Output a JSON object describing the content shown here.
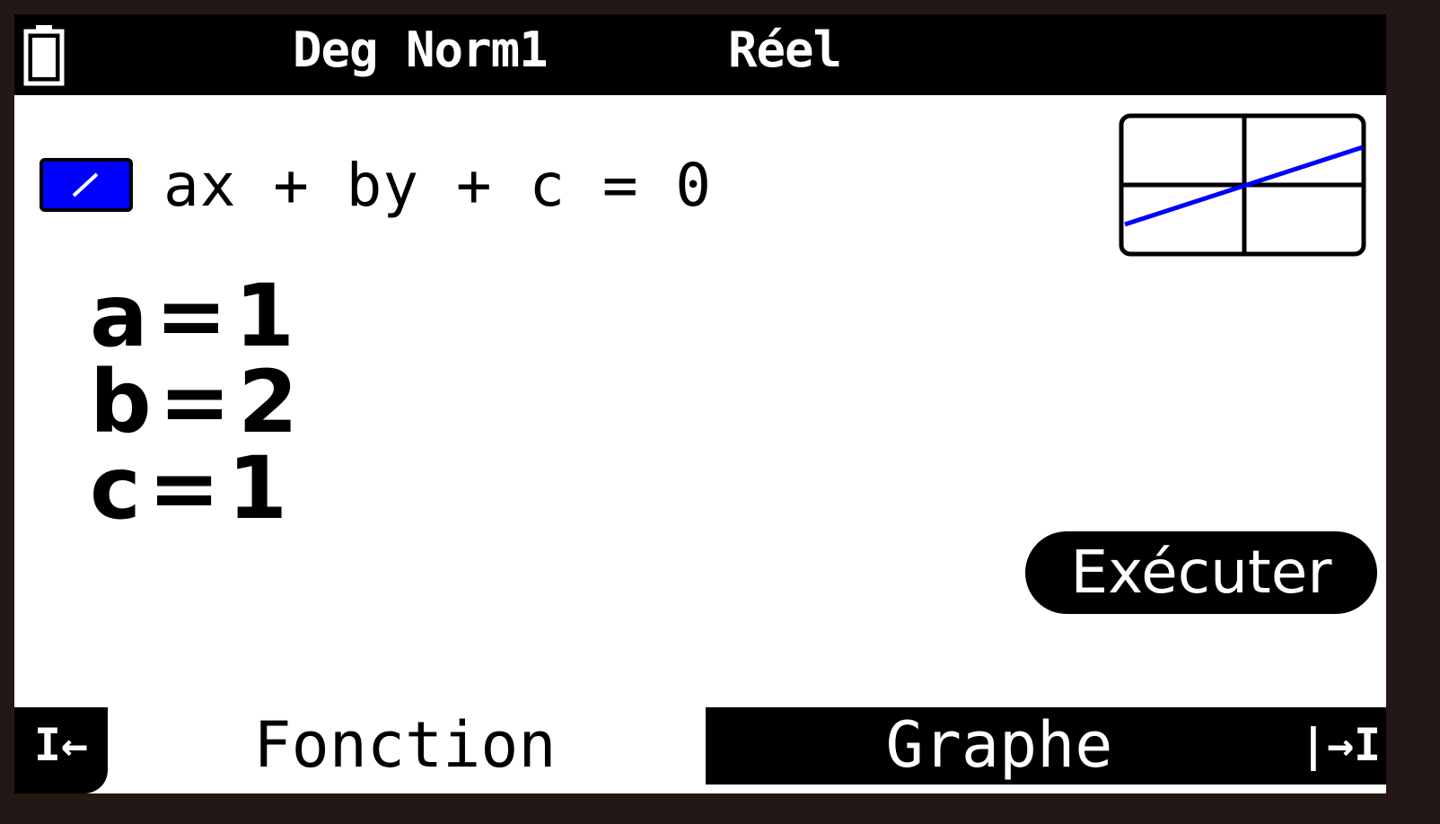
{
  "status_bar": {
    "battery_icon": "battery-icon",
    "angle_format": "Deg Norm1",
    "complex_mode": "Réel"
  },
  "equation": {
    "type_icon": "line-type-icon",
    "text": "ax + by + c = 0"
  },
  "preview": {
    "icon": "line-graph-thumbnail",
    "line_color": "#0000ff"
  },
  "coefficients": [
    {
      "name": "a",
      "eq": "=",
      "value": "1"
    },
    {
      "name": "b",
      "eq": "=",
      "value": "2"
    },
    {
      "name": "c",
      "eq": "=",
      "value": "1"
    }
  ],
  "actions": {
    "execute_label": "Exécuter"
  },
  "tabs": {
    "left_arrow": "I←",
    "function_label": "Fonction",
    "graph_label": "Graphe",
    "right_arrow": "|→I"
  }
}
